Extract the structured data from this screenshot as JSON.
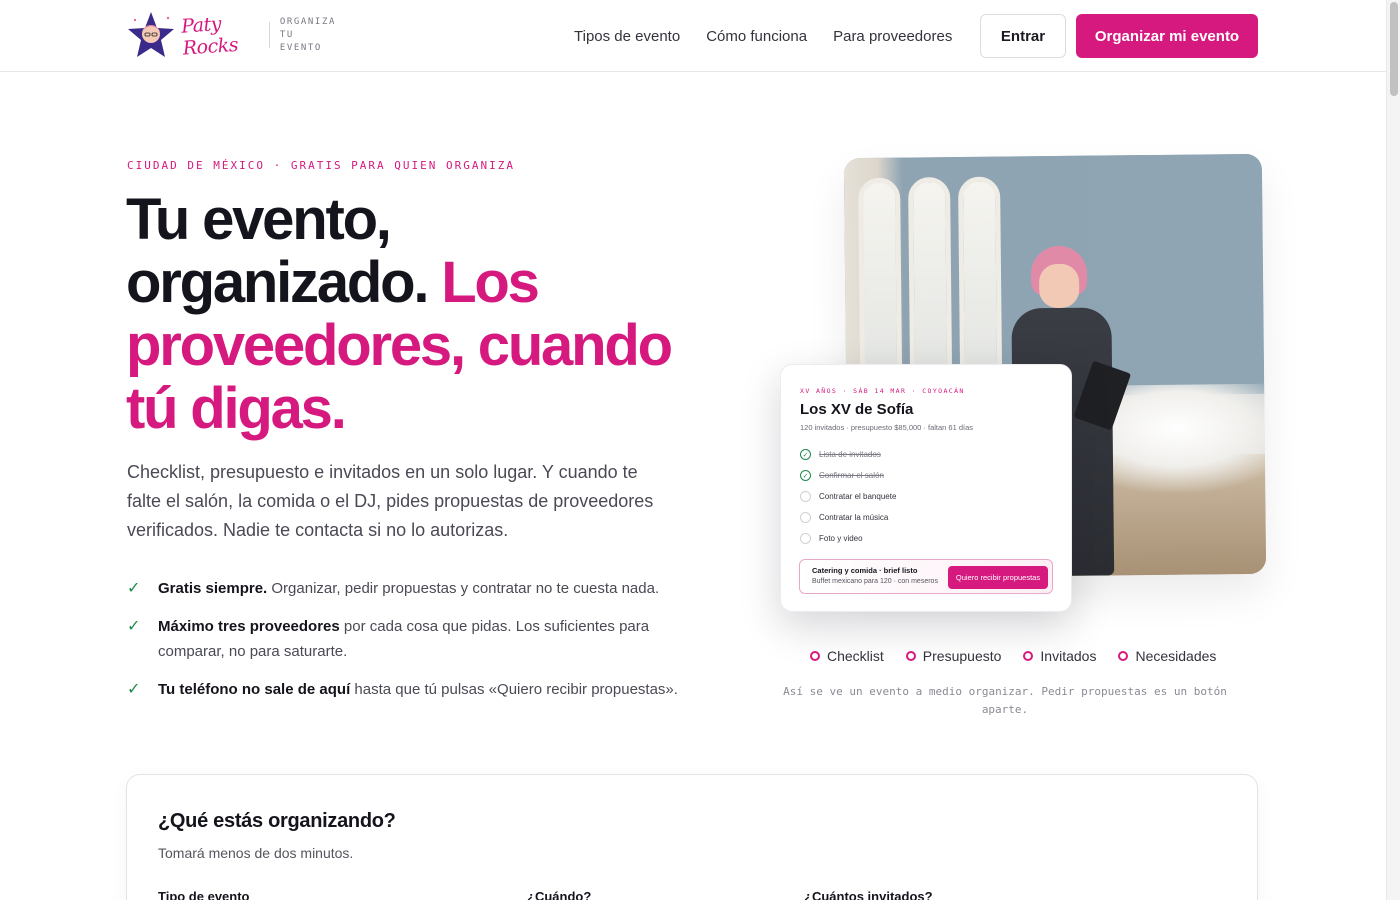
{
  "header": {
    "brand": "Paty Rocks",
    "tagline_line1": "ORGANIZA",
    "tagline_line2": "TU EVENTO",
    "nav": [
      "Tipos de evento",
      "Cómo funciona",
      "Para proveedores"
    ],
    "login_label": "Entrar",
    "cta_label": "Organizar mi evento"
  },
  "hero": {
    "eyebrow": "CIUDAD DE MÉXICO · GRATIS PARA QUIEN ORGANIZA",
    "headline_dark": "Tu evento, organizado.",
    "headline_pink": "Los proveedores, cuando tú digas.",
    "lead": "Checklist, presupuesto e invitados en un solo lugar. Y cuando te falte el salón, la comida o el DJ, pides propuestas de proveedores verificados. Nadie te contacta si no lo autorizas.",
    "bullets": [
      {
        "bold": "Gratis siempre.",
        "text": " Organizar, pedir propuestas y contratar no te cuesta nada."
      },
      {
        "bold": "Máximo tres proveedores",
        "text": " por cada cosa que pidas. Los suficientes para comparar, no para saturarte."
      },
      {
        "bold": "Tu teléfono no sale de aquí",
        "text": " hasta que tú pulsas «Quiero recibir propuestas»."
      }
    ]
  },
  "event_card": {
    "eyebrow": "XV AÑOS · SÁB 14 MAR · COYOACÁN",
    "title": "Los XV de Sofía",
    "meta": "120 invitados · presupuesto $85,000 · faltan 61 días",
    "tasks": [
      {
        "label": "Lista de invitados",
        "done": true
      },
      {
        "label": "Confirmar el salón",
        "done": true
      },
      {
        "label": "Contratar el banquete",
        "done": false
      },
      {
        "label": "Contratar la música",
        "done": false
      },
      {
        "label": "Foto y video",
        "done": false
      }
    ],
    "brief_title": "Catering y comida · brief listo",
    "brief_sub": "Buffet mexicano para 120 · con meseros",
    "brief_button": "Quiero recibir propuestas"
  },
  "legend": [
    "Checklist",
    "Presupuesto",
    "Invitados",
    "Necesidades"
  ],
  "caption": "Así se ve un evento a medio organizar. Pedir propuestas es un botón aparte.",
  "form": {
    "title": "¿Qué estás organizando?",
    "subtitle": "Tomará menos de dos minutos.",
    "labels": [
      "Tipo de evento",
      "¿Cuándo?",
      "¿Cuántos invitados?"
    ]
  },
  "colors": {
    "accent": "#d6197f",
    "check": "#1f8a4c",
    "text": "#14141c"
  }
}
